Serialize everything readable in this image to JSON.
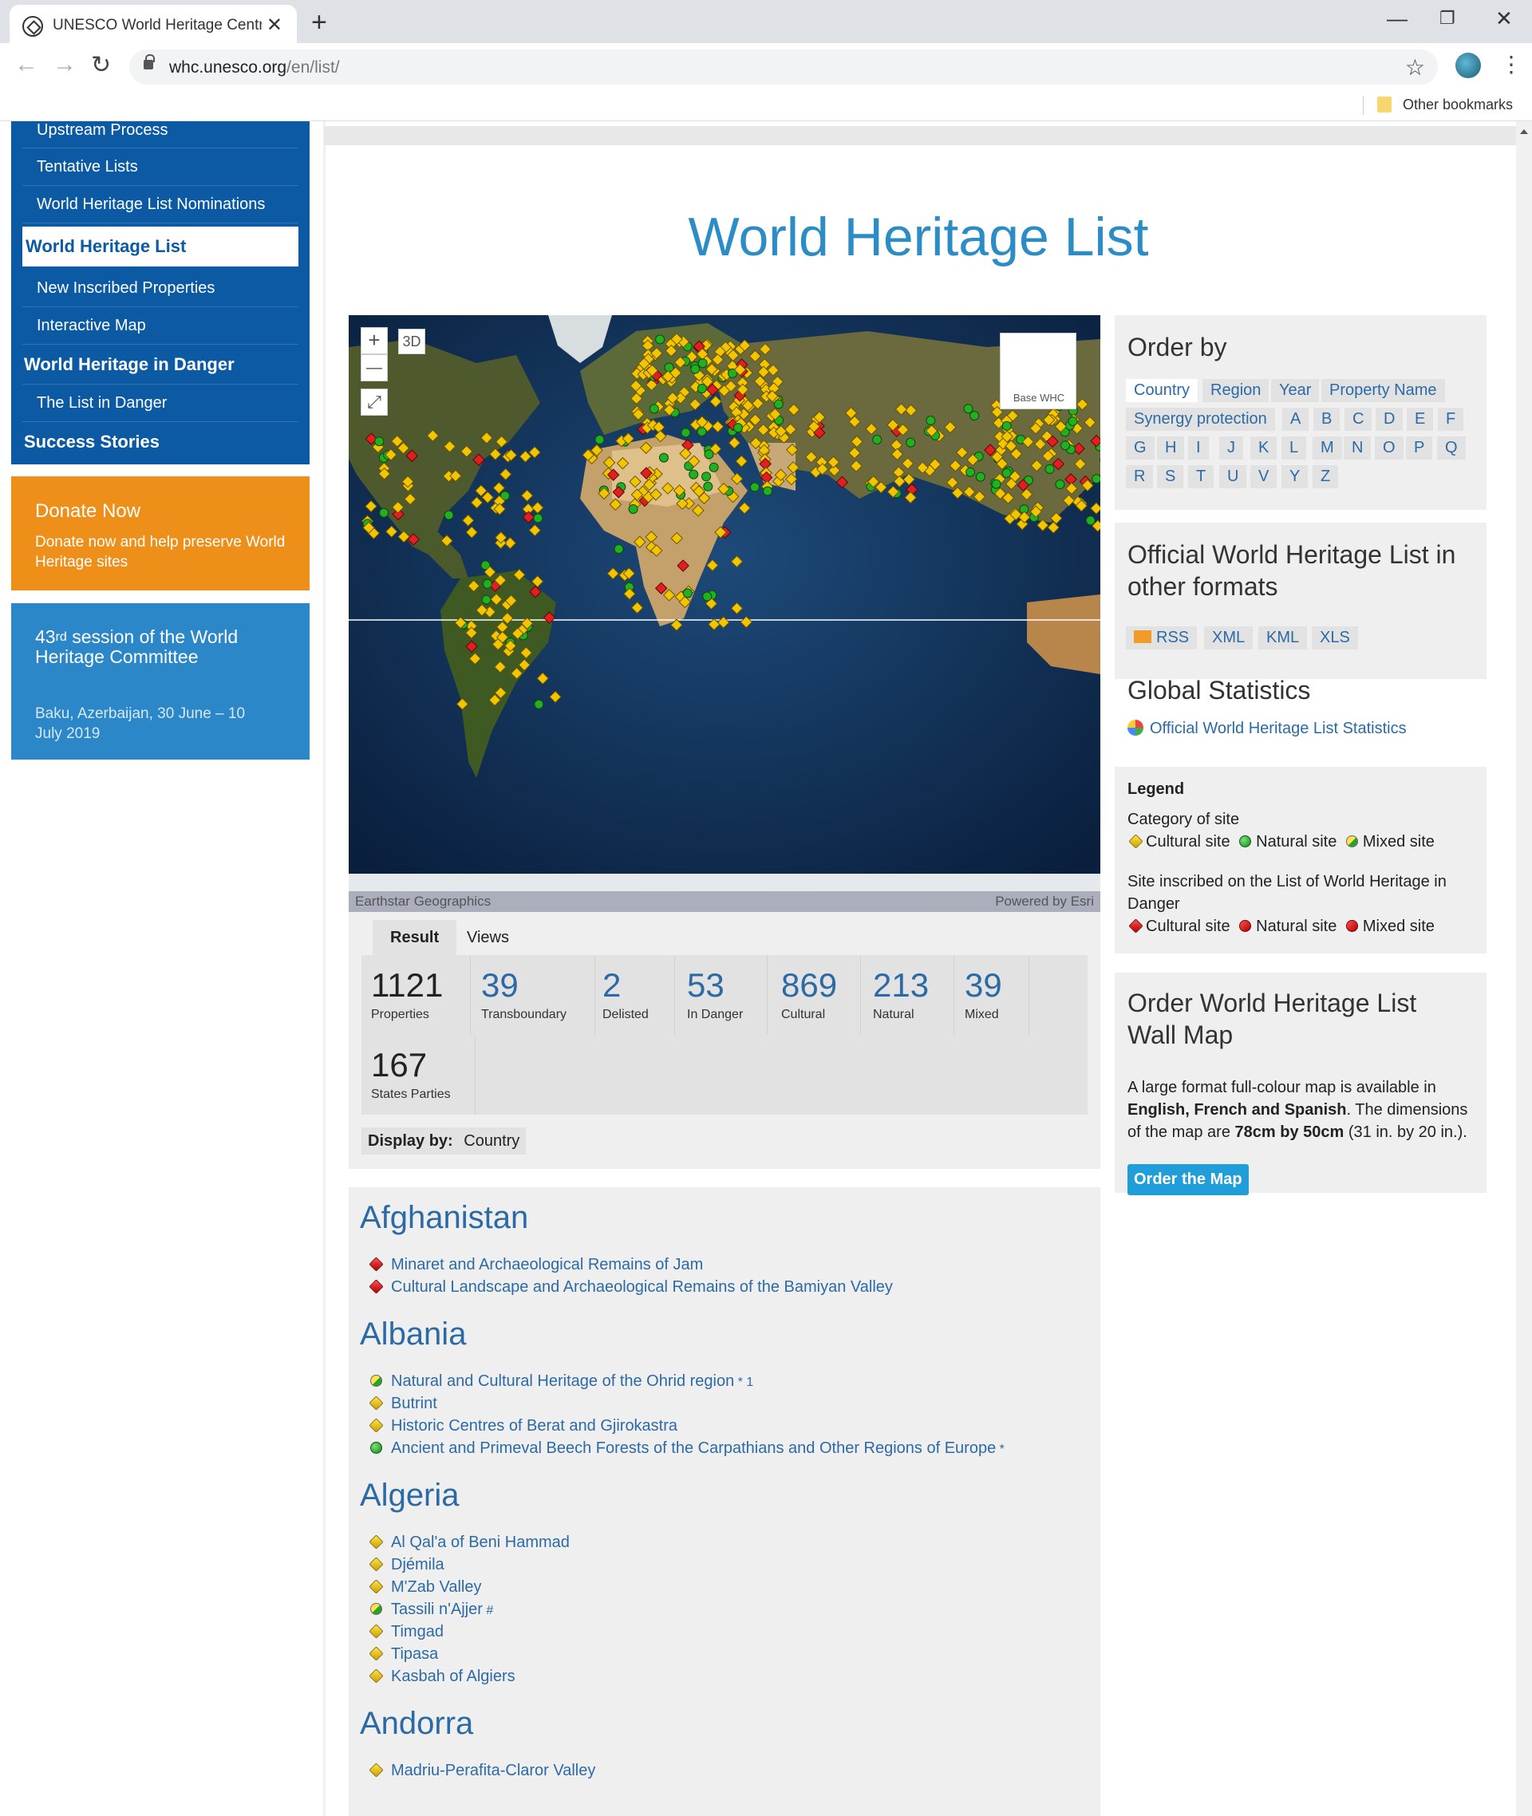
{
  "browser": {
    "tab_title": "UNESCO World Heritage Centre",
    "tab_close": "✕",
    "new_tab": "+",
    "window_controls": [
      "—",
      "❐",
      "✕"
    ],
    "url_host": "whc.unesco.org",
    "url_path": "/en/list/",
    "bookmarks_label": "Other bookmarks",
    "icons": [
      "unesco-favicon",
      "back-arrow-icon",
      "forward-arrow-icon",
      "reload-icon",
      "lock-icon",
      "star-icon",
      "profile-icon",
      "menu-icon",
      "folder-icon"
    ]
  },
  "sidebar": {
    "items": [
      {
        "label": "Upstream Process",
        "kind": "sub"
      },
      {
        "label": "Tentative Lists",
        "kind": "sub"
      },
      {
        "label": "World Heritage List Nominations",
        "kind": "sub"
      },
      {
        "label": "World Heritage List",
        "kind": "main-active"
      },
      {
        "label": "New Inscribed Properties",
        "kind": "sub"
      },
      {
        "label": "Interactive Map",
        "kind": "sub"
      },
      {
        "label": "World Heritage in Danger",
        "kind": "main"
      },
      {
        "label": "The List in Danger",
        "kind": "sub"
      },
      {
        "label": "Success Stories",
        "kind": "main"
      }
    ],
    "donate": {
      "title": "Donate Now",
      "text": "Donate now and help preserve World Heritage sites"
    },
    "session": {
      "title_num": "43",
      "title_sup": "rd",
      "title_rest": " session of the World Heritage Committee",
      "text": "Baku, Azerbaijan, 30 June – 10 July 2019"
    }
  },
  "main": {
    "title": "World Heritage List",
    "map": {
      "zoom_in": "+",
      "zoom_out": "—",
      "view_3d": "3D",
      "fullscreen": "⤢",
      "basemap_label": "Base WHC",
      "attribution_left": "Earthstar Geographics",
      "attribution_right": "Powered by Esri"
    },
    "result_tabs": [
      "Result",
      "Views"
    ],
    "stats": [
      {
        "n": "1121",
        "l": "Properties"
      },
      {
        "n": "39",
        "l": "Transboundary"
      },
      {
        "n": "2",
        "l": "Delisted"
      },
      {
        "n": "53",
        "l": "In Danger"
      },
      {
        "n": "869",
        "l": "Cultural"
      },
      {
        "n": "213",
        "l": "Natural"
      },
      {
        "n": "39",
        "l": "Mixed"
      },
      {
        "n": "167",
        "l": "States Parties"
      }
    ],
    "display_by_label": "Display by:",
    "display_by_value": "Country",
    "countries": [
      {
        "name": "Afghanistan",
        "sites": [
          {
            "name": "Minaret and Archaeological Remains of Jam",
            "cat": "dang",
            "sup": ""
          },
          {
            "name": "Cultural Landscape and Archaeological Remains of the Bamiyan Valley",
            "cat": "dang",
            "sup": ""
          }
        ]
      },
      {
        "name": "Albania",
        "sites": [
          {
            "name": "Natural and Cultural Heritage of the Ohrid region",
            "cat": "mixed",
            "sup": " * 1"
          },
          {
            "name": "Butrint",
            "cat": "cult",
            "sup": ""
          },
          {
            "name": "Historic Centres of Berat and Gjirokastra",
            "cat": "cult",
            "sup": ""
          },
          {
            "name": "Ancient and Primeval Beech Forests of the Carpathians and Other Regions of Europe",
            "cat": "nat",
            "sup": " *"
          }
        ]
      },
      {
        "name": "Algeria",
        "sites": [
          {
            "name": "Al Qal'a of Beni Hammad",
            "cat": "cult",
            "sup": ""
          },
          {
            "name": "Djémila",
            "cat": "cult",
            "sup": ""
          },
          {
            "name": "M'Zab Valley",
            "cat": "cult",
            "sup": ""
          },
          {
            "name": "Tassili n'Ajjer",
            "cat": "mixed",
            "sup": " #"
          },
          {
            "name": "Timgad",
            "cat": "cult",
            "sup": ""
          },
          {
            "name": "Tipasa",
            "cat": "cult",
            "sup": ""
          },
          {
            "name": "Kasbah of Algiers",
            "cat": "cult",
            "sup": ""
          }
        ]
      },
      {
        "name": "Andorra",
        "sites": [
          {
            "name": "Madriu-Perafita-Claror Valley",
            "cat": "cult",
            "sup": ""
          }
        ]
      }
    ]
  },
  "right": {
    "order_by": {
      "title": "Order by",
      "options": [
        "Country",
        "Region",
        "Year",
        "Property Name",
        "Synergy protection"
      ],
      "letters": [
        "A",
        "B",
        "C",
        "D",
        "E",
        "F",
        "G",
        "H",
        "I",
        "J",
        "K",
        "L",
        "M",
        "N",
        "O",
        "P",
        "Q",
        "R",
        "S",
        "T",
        "U",
        "V",
        "Y",
        "Z"
      ]
    },
    "formats": {
      "title": "Official World Heritage List in other formats",
      "items": [
        "RSS",
        "XML",
        "KML",
        "XLS"
      ]
    },
    "global_stats": {
      "title": "Global Statistics",
      "link": "Official World Heritage List Statistics"
    },
    "legend": {
      "title": "Legend",
      "category_label": "Category of site",
      "danger_label": "Site inscribed on the List of World Heritage in Danger",
      "items": [
        "Cultural site",
        "Natural site",
        "Mixed site"
      ]
    },
    "wallmap": {
      "title": "Order World Heritage List Wall Map",
      "t1": "A large format full-colour map is available in ",
      "t2": "English, French and Spanish",
      "t3": ". The dimensions of the map are ",
      "t4": "78cm by 50cm",
      "t5": " (31 in. by 20 in.).",
      "button": "Order the Map"
    }
  },
  "colors": {
    "unesco_blue": "#0b5aa3",
    "link_blue": "#2c6aa6",
    "title_blue": "#2c8cc6",
    "donate_orange": "#ee8f1a",
    "session_blue": "#2b87c7",
    "button_blue": "#1f9ed9"
  }
}
